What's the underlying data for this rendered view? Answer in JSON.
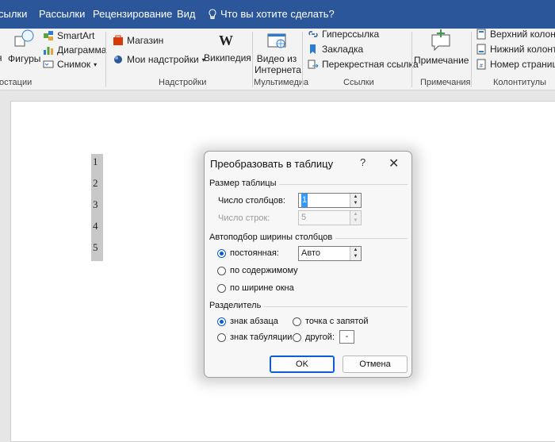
{
  "tabs": [
    {
      "label": "сылки"
    },
    {
      "label": "Рассылки"
    },
    {
      "label": "Рецензирование"
    },
    {
      "label": "Вид"
    }
  ],
  "tellme": {
    "placeholder": "Что вы хотите сделать?"
  },
  "ribbon": {
    "illustrations": {
      "shapes_label": "Фигуры",
      "partial_label": "я",
      "smartart": "SmartArt",
      "chart": "Диаграмма",
      "screenshot": "Снимок",
      "group": "остации"
    },
    "addins": {
      "store": "Магазин",
      "my_addins": "Мои надстройки",
      "wikipedia": "Википедия",
      "group": "Надстройки"
    },
    "media": {
      "online_video_line1": "Видео из",
      "online_video_line2": "Интернета",
      "group": "Мультимедиа"
    },
    "links": {
      "hyperlink": "Гиперссылка",
      "bookmark": "Закладка",
      "cross_ref": "Перекрестная ссылка",
      "group": "Ссылки"
    },
    "comments": {
      "comment": "Примечание",
      "group": "Примечания"
    },
    "header_footer": {
      "header": "Верхний колонти",
      "footer": "Нижний колонти",
      "page_number": "Номер страниц",
      "group": "Колонтитулы"
    }
  },
  "document": {
    "numbers": [
      "1",
      "2",
      "3",
      "4",
      "5"
    ]
  },
  "dialog": {
    "title": "Преобразовать в таблицу",
    "help": "?",
    "close": "✕",
    "table_size": {
      "section": "Размер таблицы",
      "columns_label": "Число столбцов:",
      "columns_value": "1",
      "rows_label": "Число строк:",
      "rows_value": "5"
    },
    "autofit": {
      "section": "Автоподбор ширины столбцов",
      "fixed_label": "постоянная:",
      "fixed_value": "Авто",
      "content_label": "по содержимому",
      "window_label": "по ширине окна",
      "selected": "fixed"
    },
    "separator": {
      "section": "Разделитель",
      "paragraph_label": "знак абзаца",
      "semicolon_label": "точка с запятой",
      "tab_label": "знак табуляции",
      "other_label": "другой:",
      "other_value": "-",
      "selected": "paragraph"
    },
    "ok": "OK",
    "cancel": "Отмена"
  },
  "colors": {
    "tabbar": "#2b579a",
    "accent": "#0b5cd6"
  }
}
